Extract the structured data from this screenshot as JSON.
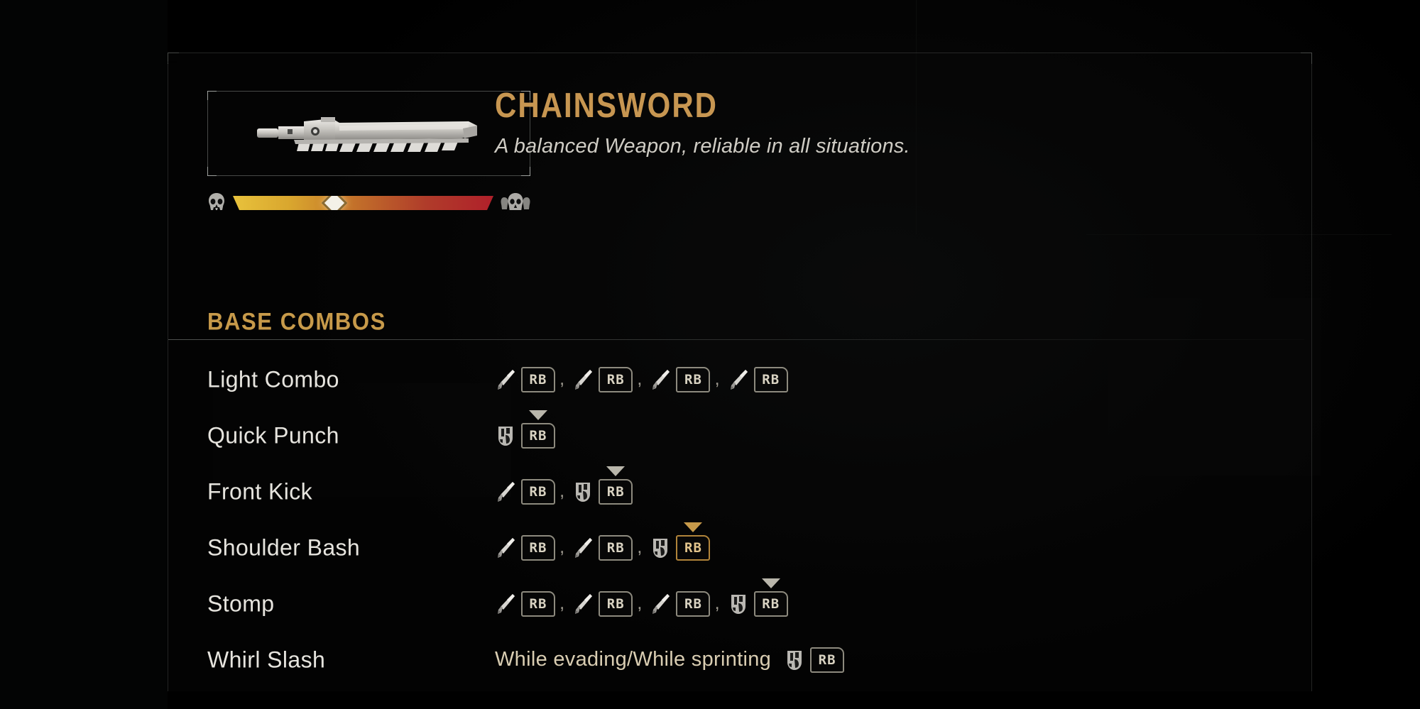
{
  "weapon": {
    "title": "CHAINSWORD",
    "description": "A balanced Weapon, reliable in all situations.",
    "art_icon": "chainsword-icon",
    "stat_bar": {
      "left_icon": "skull-icon",
      "right_icon": "skulls-icon",
      "marker_position_percent": 39,
      "gradient_from": "#e8c23c",
      "gradient_to": "#b0202a"
    }
  },
  "section": {
    "title": "BASE COMBOS",
    "accent_color": "#c79a4a"
  },
  "combos": [
    {
      "name": "Light Combo",
      "sequence": [
        {
          "action_icon": "sword-icon",
          "key": "RB",
          "hold": false,
          "gold": false
        },
        {
          "action_icon": "sword-icon",
          "key": "RB",
          "hold": false,
          "gold": false
        },
        {
          "action_icon": "sword-icon",
          "key": "RB",
          "hold": false,
          "gold": false
        },
        {
          "action_icon": "sword-icon",
          "key": "RB",
          "hold": false,
          "gold": false
        }
      ]
    },
    {
      "name": "Quick Punch",
      "sequence": [
        {
          "action_icon": "fist-icon",
          "key": "RB",
          "hold": true,
          "gold": false
        }
      ]
    },
    {
      "name": "Front Kick",
      "sequence": [
        {
          "action_icon": "sword-icon",
          "key": "RB",
          "hold": false,
          "gold": false
        },
        {
          "action_icon": "fist-icon",
          "key": "RB",
          "hold": true,
          "gold": false
        }
      ]
    },
    {
      "name": "Shoulder Bash",
      "sequence": [
        {
          "action_icon": "sword-icon",
          "key": "RB",
          "hold": false,
          "gold": false
        },
        {
          "action_icon": "sword-icon",
          "key": "RB",
          "hold": false,
          "gold": false
        },
        {
          "action_icon": "fist-icon",
          "key": "RB",
          "hold": true,
          "gold": true
        }
      ]
    },
    {
      "name": "Stomp",
      "sequence": [
        {
          "action_icon": "sword-icon",
          "key": "RB",
          "hold": false,
          "gold": false
        },
        {
          "action_icon": "sword-icon",
          "key": "RB",
          "hold": false,
          "gold": false
        },
        {
          "action_icon": "sword-icon",
          "key": "RB",
          "hold": false,
          "gold": false
        },
        {
          "action_icon": "fist-icon",
          "key": "RB",
          "hold": true,
          "gold": false
        }
      ]
    },
    {
      "name": "Whirl Slash",
      "condition": "While evading/While sprinting",
      "sequence": [
        {
          "action_icon": "fist-icon",
          "key": "RB",
          "hold": false,
          "gold": false
        }
      ]
    }
  ],
  "separator": ","
}
